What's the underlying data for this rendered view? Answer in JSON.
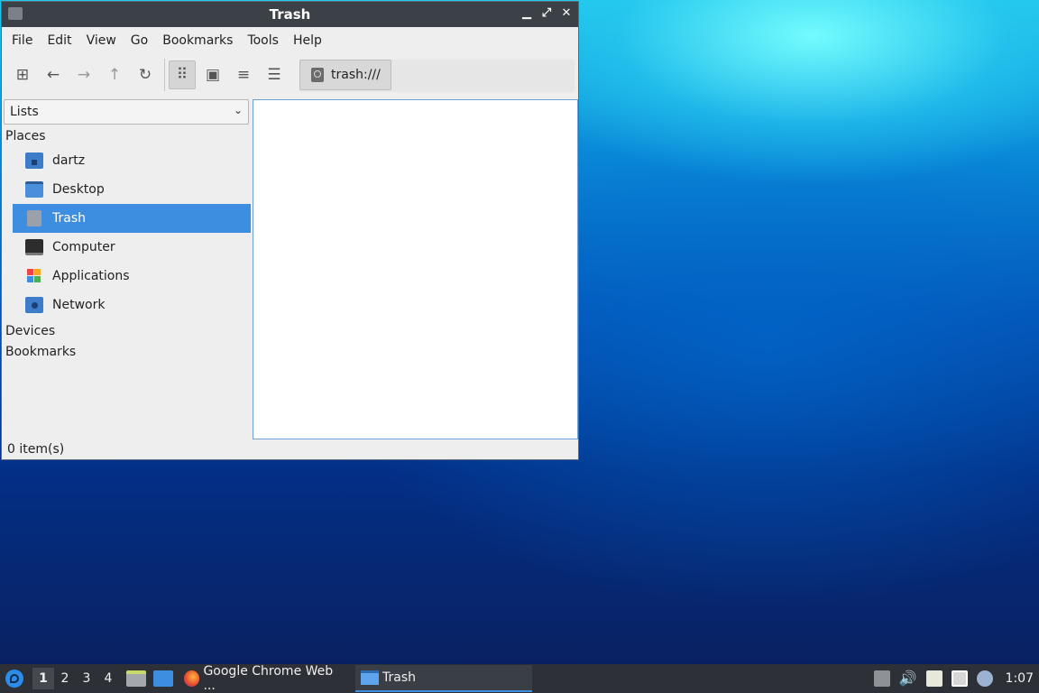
{
  "window": {
    "title": "Trash",
    "controls": {
      "minimize": "▁",
      "maximize": "⤢",
      "close": "✕"
    }
  },
  "menubar": [
    "File",
    "Edit",
    "View",
    "Go",
    "Bookmarks",
    "Tools",
    "Help"
  ],
  "toolbar": {
    "buttons": [
      {
        "name": "new-window-icon",
        "glyph": "⊞"
      },
      {
        "name": "back-arrow-icon",
        "glyph": "←"
      },
      {
        "name": "forward-arrow-icon",
        "glyph": "→"
      },
      {
        "name": "up-arrow-icon",
        "glyph": "↑"
      },
      {
        "name": "reload-icon",
        "glyph": "↻"
      },
      {
        "name": "icon-view-icon",
        "glyph": "⠿"
      },
      {
        "name": "thumbnail-view-icon",
        "glyph": "▣"
      },
      {
        "name": "compact-view-icon",
        "glyph": "≡"
      },
      {
        "name": "detailed-list-view-icon",
        "glyph": "☰"
      }
    ],
    "location": "trash:///"
  },
  "sidebar": {
    "mode": "Lists",
    "sections": {
      "places": "Places",
      "devices": "Devices",
      "bookmarks": "Bookmarks"
    },
    "places": [
      {
        "label": "dartz",
        "icon": "home-folder-icon"
      },
      {
        "label": "Desktop",
        "icon": "desktop-icon"
      },
      {
        "label": "Trash",
        "icon": "trash-icon",
        "selected": true
      },
      {
        "label": "Computer",
        "icon": "computer-icon"
      },
      {
        "label": "Applications",
        "icon": "applications-icon"
      },
      {
        "label": "Network",
        "icon": "network-icon"
      }
    ]
  },
  "status": "0 item(s)",
  "taskbar": {
    "desktops": [
      "1",
      "2",
      "3",
      "4"
    ],
    "active_desktop": "1",
    "tasks": [
      {
        "label": "Google Chrome Web ...",
        "icon": "firefox-icon"
      },
      {
        "label": "Trash",
        "icon": "folder-icon",
        "active": true
      }
    ],
    "clock": "1:07",
    "volume_glyph": "🔊"
  },
  "colors": {
    "selection": "#3d8ee0",
    "titlebar": "#3c4047",
    "taskbar": "#2d3036"
  }
}
